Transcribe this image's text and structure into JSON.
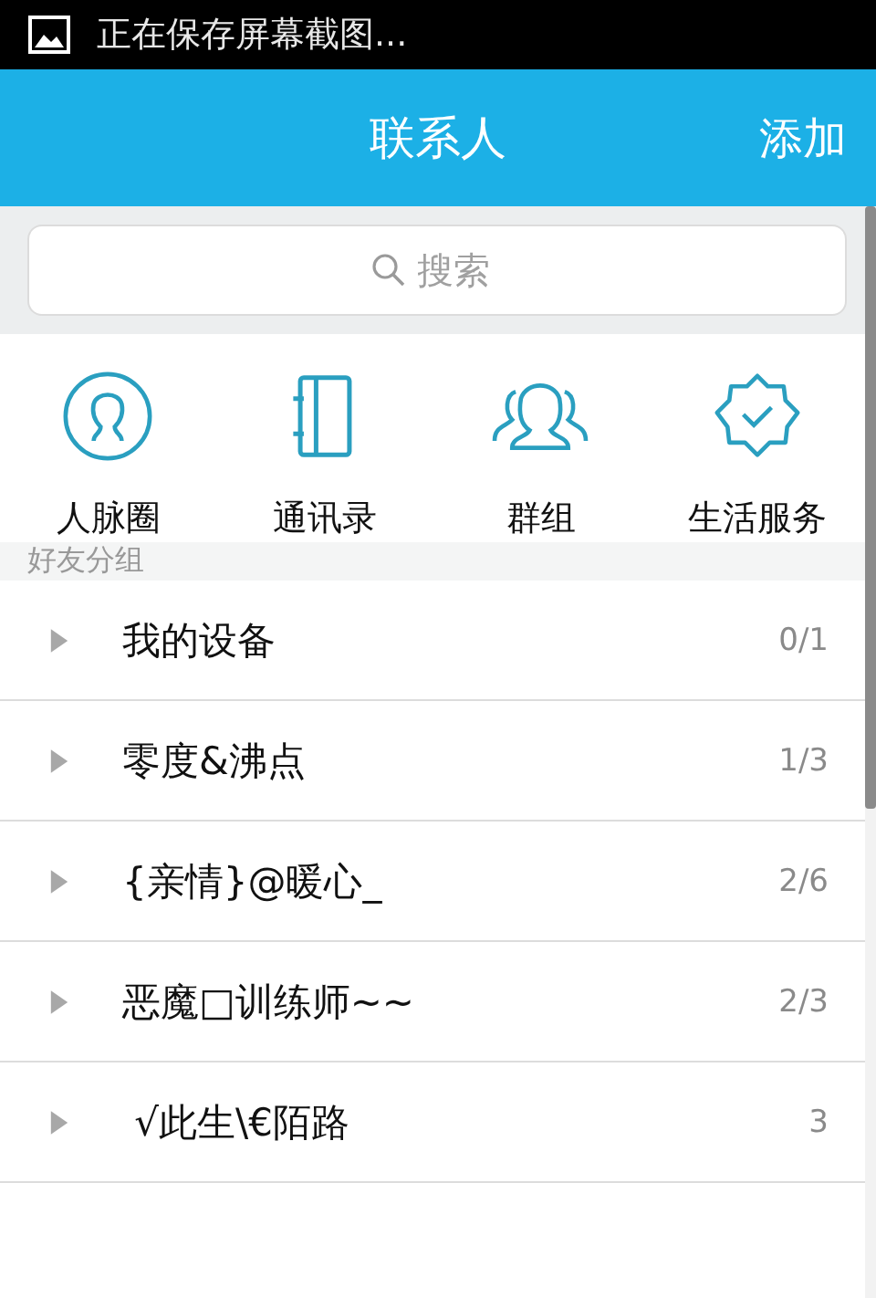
{
  "status_bar": {
    "notification": "正在保存屏幕截图..."
  },
  "header": {
    "title": "联系人",
    "action": "添加"
  },
  "search": {
    "placeholder": "搜索"
  },
  "shortcuts": [
    {
      "kind": "circle",
      "label": "人脉圈"
    },
    {
      "kind": "book",
      "label": "通讯录"
    },
    {
      "kind": "group",
      "label": "群组"
    },
    {
      "kind": "badge",
      "label": "生活服务"
    }
  ],
  "section": {
    "title": "好友分组"
  },
  "groups": [
    {
      "name": "我的设备",
      "count": "0/1",
      "expanded": false
    },
    {
      "name": "零度&沸点",
      "count": "1/3",
      "expanded": false
    },
    {
      "name": "{亲情}@暖心_",
      "count": "2/6",
      "expanded": false
    },
    {
      "name": "恶魔□训练师~~",
      "count": "2/3",
      "expanded": false
    },
    {
      "name": " √此生\\€陌路",
      "count": "3",
      "expanded": false
    }
  ]
}
